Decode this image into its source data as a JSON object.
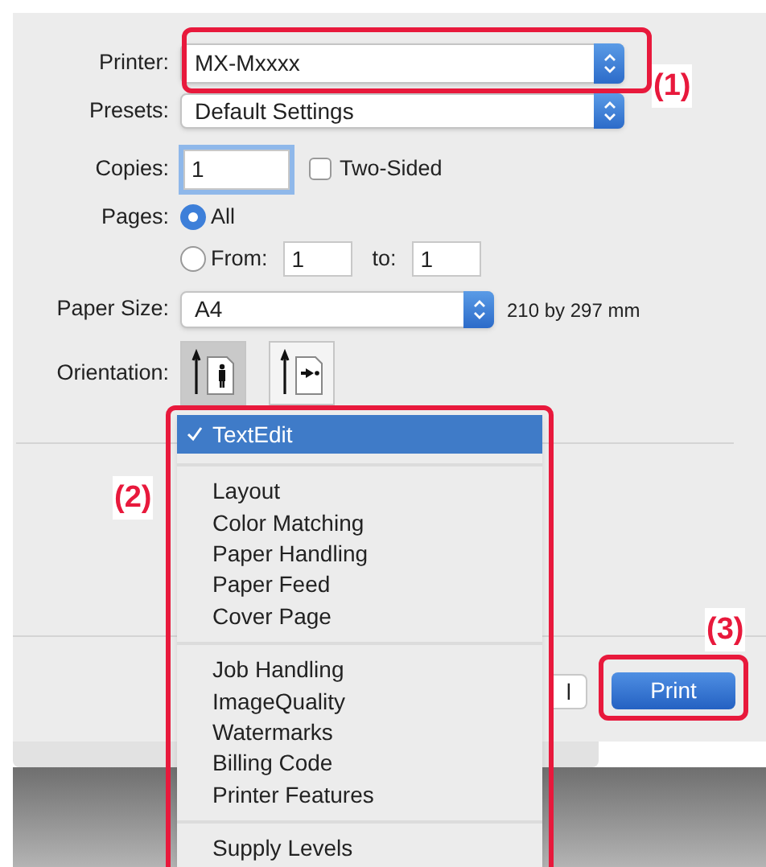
{
  "dialog": {
    "printer": {
      "label": "Printer:",
      "value": "MX-Mxxxx"
    },
    "presets": {
      "label": "Presets:",
      "value": "Default Settings"
    },
    "copies": {
      "label": "Copies:",
      "value": "1"
    },
    "two_sided": {
      "label": "Two-Sided",
      "checked": false
    },
    "pages": {
      "label": "Pages:",
      "options": [
        {
          "label": "All",
          "selected": true
        },
        {
          "label": "From:",
          "selected": false
        }
      ],
      "from": "1",
      "to_label": "to:",
      "to": "1"
    },
    "paper_size": {
      "label": "Paper Size:",
      "value": "A4",
      "dimensions": "210 by 297 mm"
    },
    "orientation": {
      "label": "Orientation:",
      "options": [
        {
          "kind": "portrait",
          "selected": true
        },
        {
          "kind": "landscape",
          "selected": false
        }
      ]
    },
    "buttons": [
      {
        "kind": "cancel",
        "label": "l"
      },
      {
        "kind": "default",
        "label": "Print"
      }
    ]
  },
  "menu": {
    "groups": [
      {
        "items": [
          {
            "label": "TextEdit",
            "selected": true
          }
        ]
      },
      {
        "items": [
          {
            "label": "Layout",
            "selected": false
          },
          {
            "label": "Color Matching",
            "selected": false
          },
          {
            "label": "Paper Handling",
            "selected": false
          },
          {
            "label": "Paper Feed",
            "selected": false
          },
          {
            "label": "Cover Page",
            "selected": false
          }
        ]
      },
      {
        "items": [
          {
            "label": "Job Handling",
            "selected": false
          },
          {
            "label": "ImageQuality",
            "selected": false
          },
          {
            "label": "Watermarks",
            "selected": false
          },
          {
            "label": "Billing Code",
            "selected": false
          },
          {
            "label": "Printer Features",
            "selected": false
          }
        ]
      },
      {
        "items": [
          {
            "label": "Supply Levels",
            "selected": false
          }
        ]
      }
    ]
  },
  "callouts": [
    "(1)",
    "(2)",
    "(3)"
  ]
}
